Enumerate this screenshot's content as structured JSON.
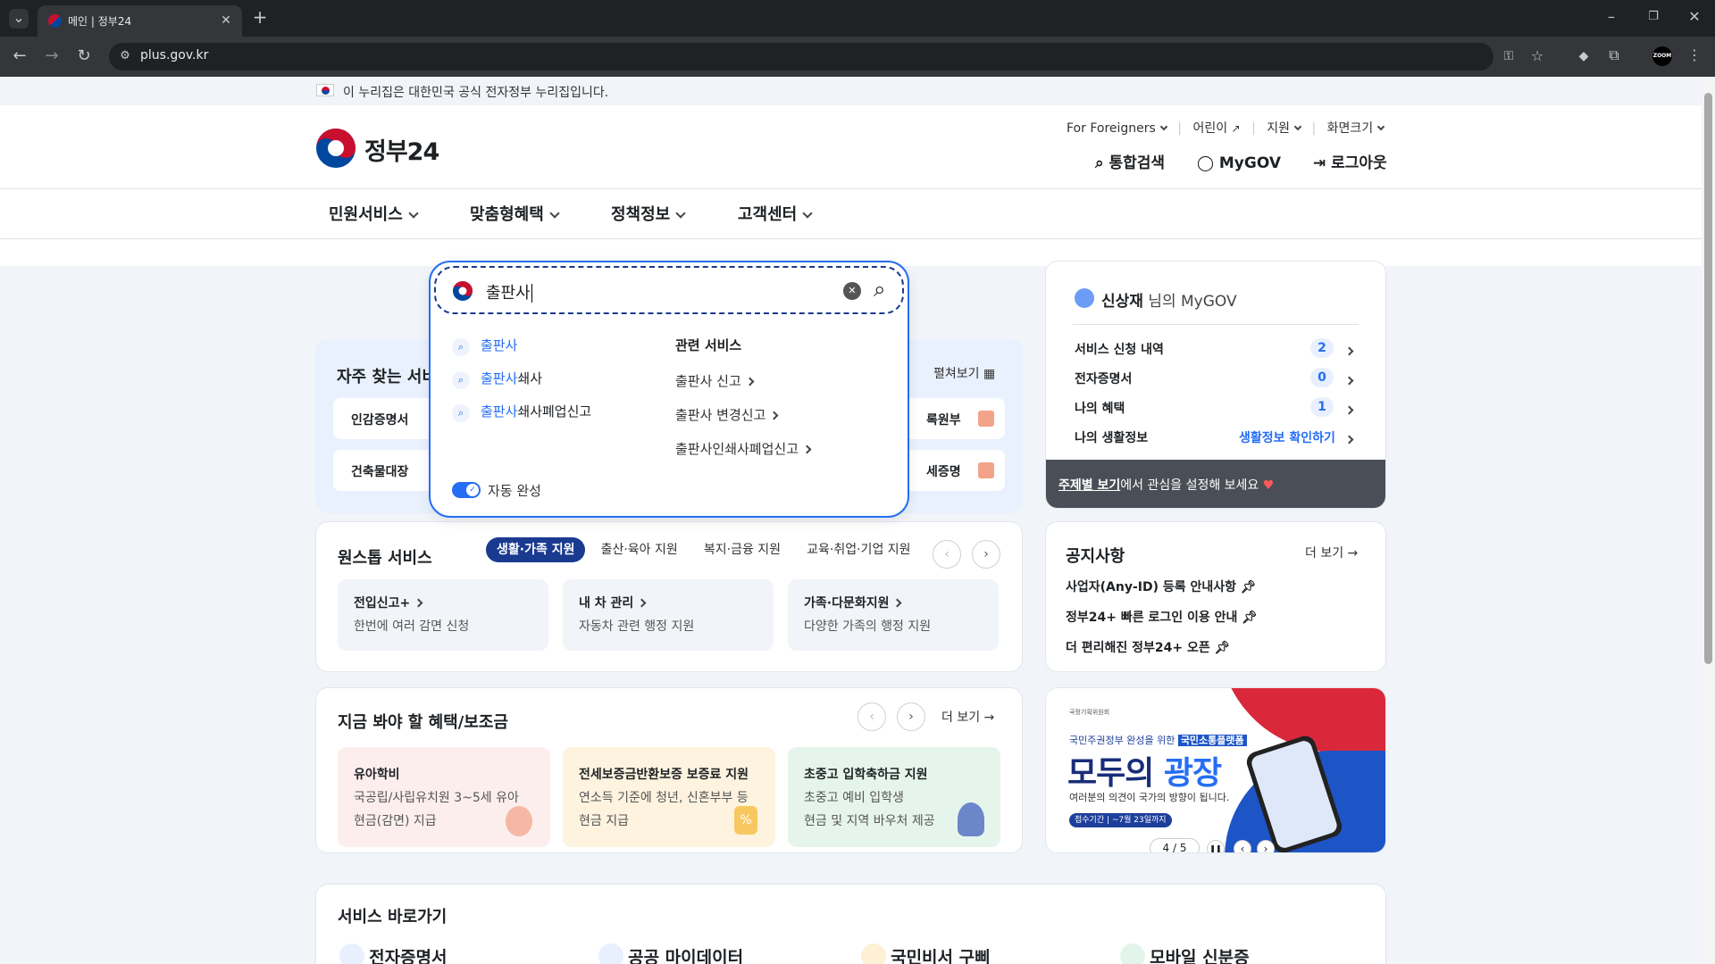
{
  "browser": {
    "tab_title": "메인 | 정부24",
    "url": "plus.gov.kr",
    "extension_label": "ZOOM"
  },
  "gov_banner": {
    "text": "이 누리집은 대한민국 공식 전자정부 누리집입니다."
  },
  "header": {
    "logo_text": "정부24",
    "util_links": [
      "For Foreigners",
      "어린이",
      "지원",
      "화면크기"
    ],
    "actions": {
      "search": "통합검색",
      "mygov": "MyGOV",
      "logout": "로그아웃"
    }
  },
  "nav": {
    "items": [
      "민원서비스",
      "맞춤형혜택",
      "정책정보",
      "고객센터"
    ]
  },
  "search": {
    "query": "출판사",
    "suggestions": [
      {
        "match": "출판사",
        "rest": ""
      },
      {
        "match": "출판사",
        "rest": "쇄사"
      },
      {
        "match": "출판사",
        "rest": "쇄사폐업신고"
      }
    ],
    "related_title": "관련 서비스",
    "related": [
      "출판사 신고",
      "출판사 변경신고",
      "출판사인쇄사폐업신고"
    ],
    "autocomplete_label": "자동 완성"
  },
  "frequent": {
    "title": "자주 찾는 서비",
    "expand": "펼쳐보기",
    "items": [
      "인감증명서",
      "건축물대장",
      "록원부",
      "세증명"
    ]
  },
  "mygov": {
    "user": "신상재",
    "suffix": "님의 MyGOV",
    "rows": [
      {
        "label": "서비스 신청 내역",
        "value": "2"
      },
      {
        "label": "전자증명서",
        "value": "0"
      },
      {
        "label": "나의 혜택",
        "value": "1"
      },
      {
        "label": "나의 생활정보",
        "value": "생활정보 확인하기"
      }
    ],
    "footer_link": "주제별 보기",
    "footer_rest": "에서 관심을 설정해 보세요"
  },
  "onestop": {
    "title": "원스톱 서비스",
    "tabs": [
      "생활·가족 지원",
      "출산·육아 지원",
      "복지·금융 지원",
      "교육·취업·기업 지원"
    ],
    "cards": [
      {
        "title": "전입신고+",
        "desc": "한번에 여러 감면 신청"
      },
      {
        "title": "내 차 관리",
        "desc": "자동차 관련 행정 지원"
      },
      {
        "title": "가족·다문화지원",
        "desc": "다양한 가족의 행정 지원"
      }
    ]
  },
  "notices": {
    "title": "공지사항",
    "more": "더 보기",
    "items": [
      "사업자(Any-ID) 등록 안내사항",
      "정부24+ 빠른 로그인 이용 안내",
      "더 편리해진 정부24+ 오픈"
    ]
  },
  "benefits": {
    "title": "지금 봐야 할 혜택/보조금",
    "more": "더 보기",
    "cards": [
      {
        "title": "유아학비",
        "line1": "국공립/사립유치원 3~5세 유아",
        "line2": "현금(감면) 지급",
        "bg": "#fdeeee"
      },
      {
        "title": "전세보증금반환보증 보증료 지원",
        "line1": "연소득 기준에 청년, 신혼부부 등",
        "line2": "현금 지급",
        "bg": "#fdf3df"
      },
      {
        "title": "초중고 입학축하금 지원",
        "line1": "초중고 예비 입학생",
        "line2": "현금 및 지역 바우처 제공",
        "bg": "#e6f5ec"
      }
    ]
  },
  "promo": {
    "org": "국정기획위원회",
    "line1": "국민주권정부 완성을 위한",
    "highlight": "국민소통플랫폼",
    "headline_a": "모두의",
    "headline_b": "광장",
    "subline": "여러분의 의견이 국가의 방향이 됩니다.",
    "period": "접수기간 | ~7월 23일까지",
    "pager": "4 / 5"
  },
  "shortcuts": {
    "title": "서비스 바로가기",
    "items": [
      "전자증명서",
      "공공 마이데이터",
      "국민비서 구삐",
      "모바일 신분증"
    ]
  },
  "colors": {
    "accent": "#256ef4",
    "navy": "#1a3a8f",
    "dark": "#4a4f57"
  }
}
